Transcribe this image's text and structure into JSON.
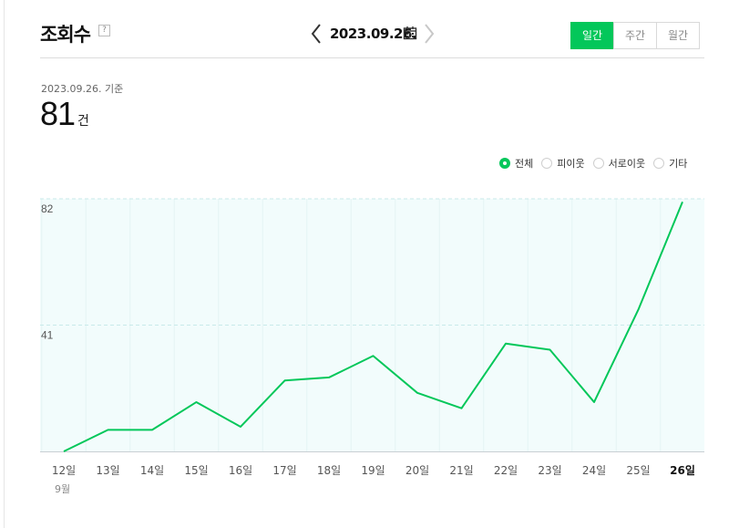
{
  "header": {
    "title": "조회수",
    "help": "?",
    "date": "2023.09.26.",
    "period_tabs": [
      {
        "label": "일간",
        "active": true
      },
      {
        "label": "주간",
        "active": false
      },
      {
        "label": "월간",
        "active": false
      }
    ]
  },
  "summary": {
    "basis": "2023.09.26. 기준",
    "count": "81",
    "unit": "건"
  },
  "filters": [
    {
      "label": "전체",
      "checked": true
    },
    {
      "label": "피이웃",
      "checked": false
    },
    {
      "label": "서로이웃",
      "checked": false
    },
    {
      "label": "기타",
      "checked": false
    }
  ],
  "colors": {
    "accent": "#03c75a",
    "plot_bg": "#f2fcfc",
    "grid": "#c8eaea"
  },
  "chart_data": {
    "type": "line",
    "categories": [
      "12일",
      "13일",
      "14일",
      "15일",
      "16일",
      "17일",
      "18일",
      "19일",
      "20일",
      "21일",
      "22일",
      "23일",
      "24일",
      "25일",
      "26일"
    ],
    "highlight_category": "26일",
    "month_label": "9월",
    "series": [
      {
        "values": [
          0,
          7,
          7,
          16,
          8,
          23,
          24,
          31,
          19,
          14,
          35,
          33,
          16,
          46,
          81
        ]
      }
    ],
    "yticks": [
      82,
      41
    ],
    "ylim": [
      0,
      82
    ],
    "grid": true,
    "legend": "none"
  }
}
